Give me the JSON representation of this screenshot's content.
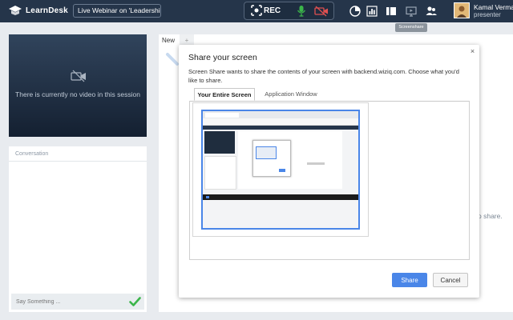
{
  "topbar": {
    "logo_text": "LearnDesk",
    "webinar_title": "Live Webinar on 'Leadership;",
    "rec_label": "REC",
    "tooltip": "Screenshare",
    "user": {
      "name": "Kamal Verma",
      "role": "presenter"
    },
    "icons": [
      "rec-icon",
      "mic-icon",
      "camera-off-icon",
      "timer-icon",
      "chart-icon",
      "layout-icon",
      "screenshare-icon",
      "users-icon"
    ]
  },
  "video": {
    "message": "There is currently no video in this session"
  },
  "conversation": {
    "header": "Conversation",
    "placeholder": "Say Something ..."
  },
  "board": {
    "tab_new": "New",
    "tab_add": "+",
    "behind_text": "o share."
  },
  "dialog": {
    "title": "Share your screen",
    "close": "×",
    "description": "Screen Share wants to share the contents of your screen with backend.wiziq.com. Choose what you'd like to share.",
    "tabs": [
      "Your Entire Screen",
      "Application Window"
    ],
    "share_label": "Share",
    "cancel_label": "Cancel"
  },
  "colors": {
    "topbar": "#25354a",
    "accent": "#4a86e8",
    "send": "#3bb54a",
    "mic": "#3bb54a",
    "cam_off": "#e05050"
  }
}
